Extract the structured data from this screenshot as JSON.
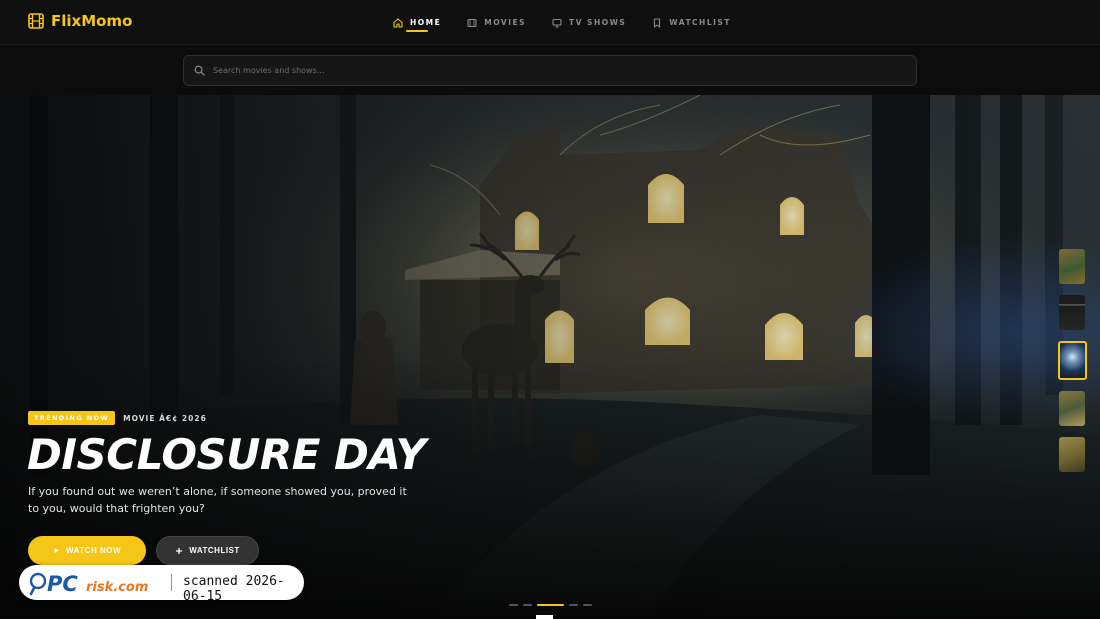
{
  "app": {
    "name": "FlixMomo",
    "logo_icon": "film-icon",
    "accent_color": "#f5c518"
  },
  "nav": {
    "items": [
      {
        "label": "HOME",
        "icon": "home-icon",
        "active": true
      },
      {
        "label": "MOVIES",
        "icon": "film-icon",
        "active": false
      },
      {
        "label": "TV SHOWS",
        "icon": "tv-icon",
        "active": false
      },
      {
        "label": "WATCHLIST",
        "icon": "bookmark-icon",
        "active": false
      }
    ]
  },
  "search": {
    "placeholder": "Search movies and shows...",
    "value": ""
  },
  "hero": {
    "badge": "TRENDING NOW",
    "meta": "MOVIE Â€¢ 2026",
    "title": "DISCLOSURE DAY",
    "description": "If you found out we weren’t alone, if someone showed you, proved it to you, would that frighten you?",
    "watch_label": "WATCH NOW",
    "watchlist_label": "WATCHLIST"
  },
  "carousel": {
    "slide_count": 5,
    "active_index": 2
  },
  "watermark": {
    "brand": "PCrisk.com",
    "text": "scanned 2026-06-15"
  }
}
